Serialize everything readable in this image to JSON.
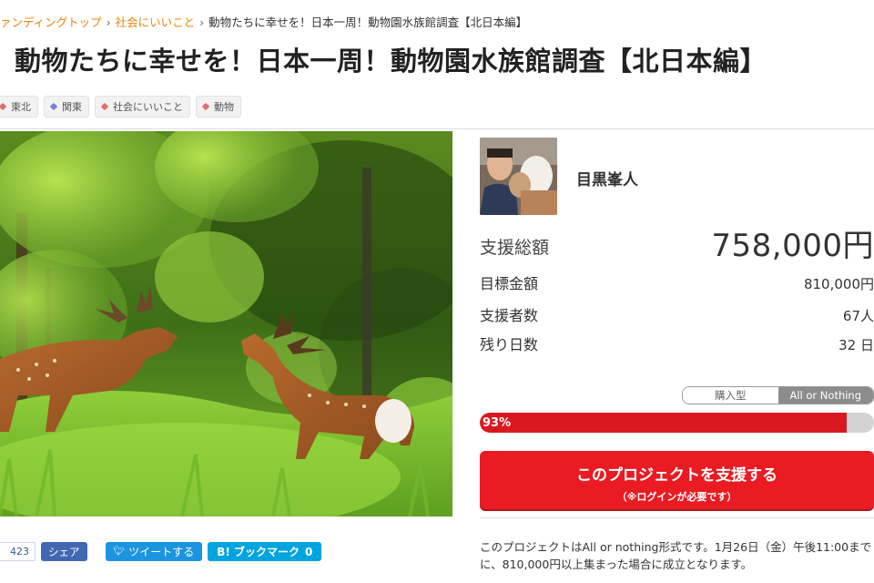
{
  "breadcrumb": {
    "items": [
      "ァンディングトップ",
      "社会にいいこと"
    ],
    "separator": "›",
    "current": "動物たちに幸せを！日本一周！動物園水族館調査【北日本編】"
  },
  "title": "動物たちに幸せを！日本一周！動物園水族館調査【北日本編】",
  "tags": [
    {
      "icon": "tag-icon",
      "label": "東北"
    },
    {
      "icon": "tag-icon",
      "label": "関東"
    },
    {
      "icon": "tag-icon",
      "label": "社会にいいこと"
    },
    {
      "icon": "tag-icon",
      "label": "動物"
    }
  ],
  "owner": {
    "name": "目黒峯人"
  },
  "stats": {
    "total_label": "支援総額",
    "total_value": "758,000円",
    "goal_label": "目標金額",
    "goal_value": "810,000円",
    "backers_label": "支援者数",
    "backers_value": "67人",
    "days_label": "残り日数",
    "days_value": "32 日"
  },
  "funding_type": {
    "options": [
      "購入型",
      "All or Nothing"
    ],
    "selected": "All or Nothing"
  },
  "progress": {
    "label": "93%",
    "percent": 93
  },
  "support_button": {
    "label": "このプロジェクトを支援する",
    "sublabel": "（※ログインが必要です）"
  },
  "share": {
    "fb_count": "423",
    "fb_share": "シェア",
    "tweet": "ツイートする",
    "hatena": "B! ブックマーク",
    "hatena_count": "0"
  },
  "note": "このプロジェクトはAll or nothing形式です。1月26日（金）午後11:00までに、810,000円以上集まった場合に成立となります。",
  "colors": {
    "accent": "#ea1b22",
    "link": "#e8850c",
    "twitter": "#1b95e0",
    "facebook": "#4267b2",
    "hatena": "#00a4de"
  }
}
